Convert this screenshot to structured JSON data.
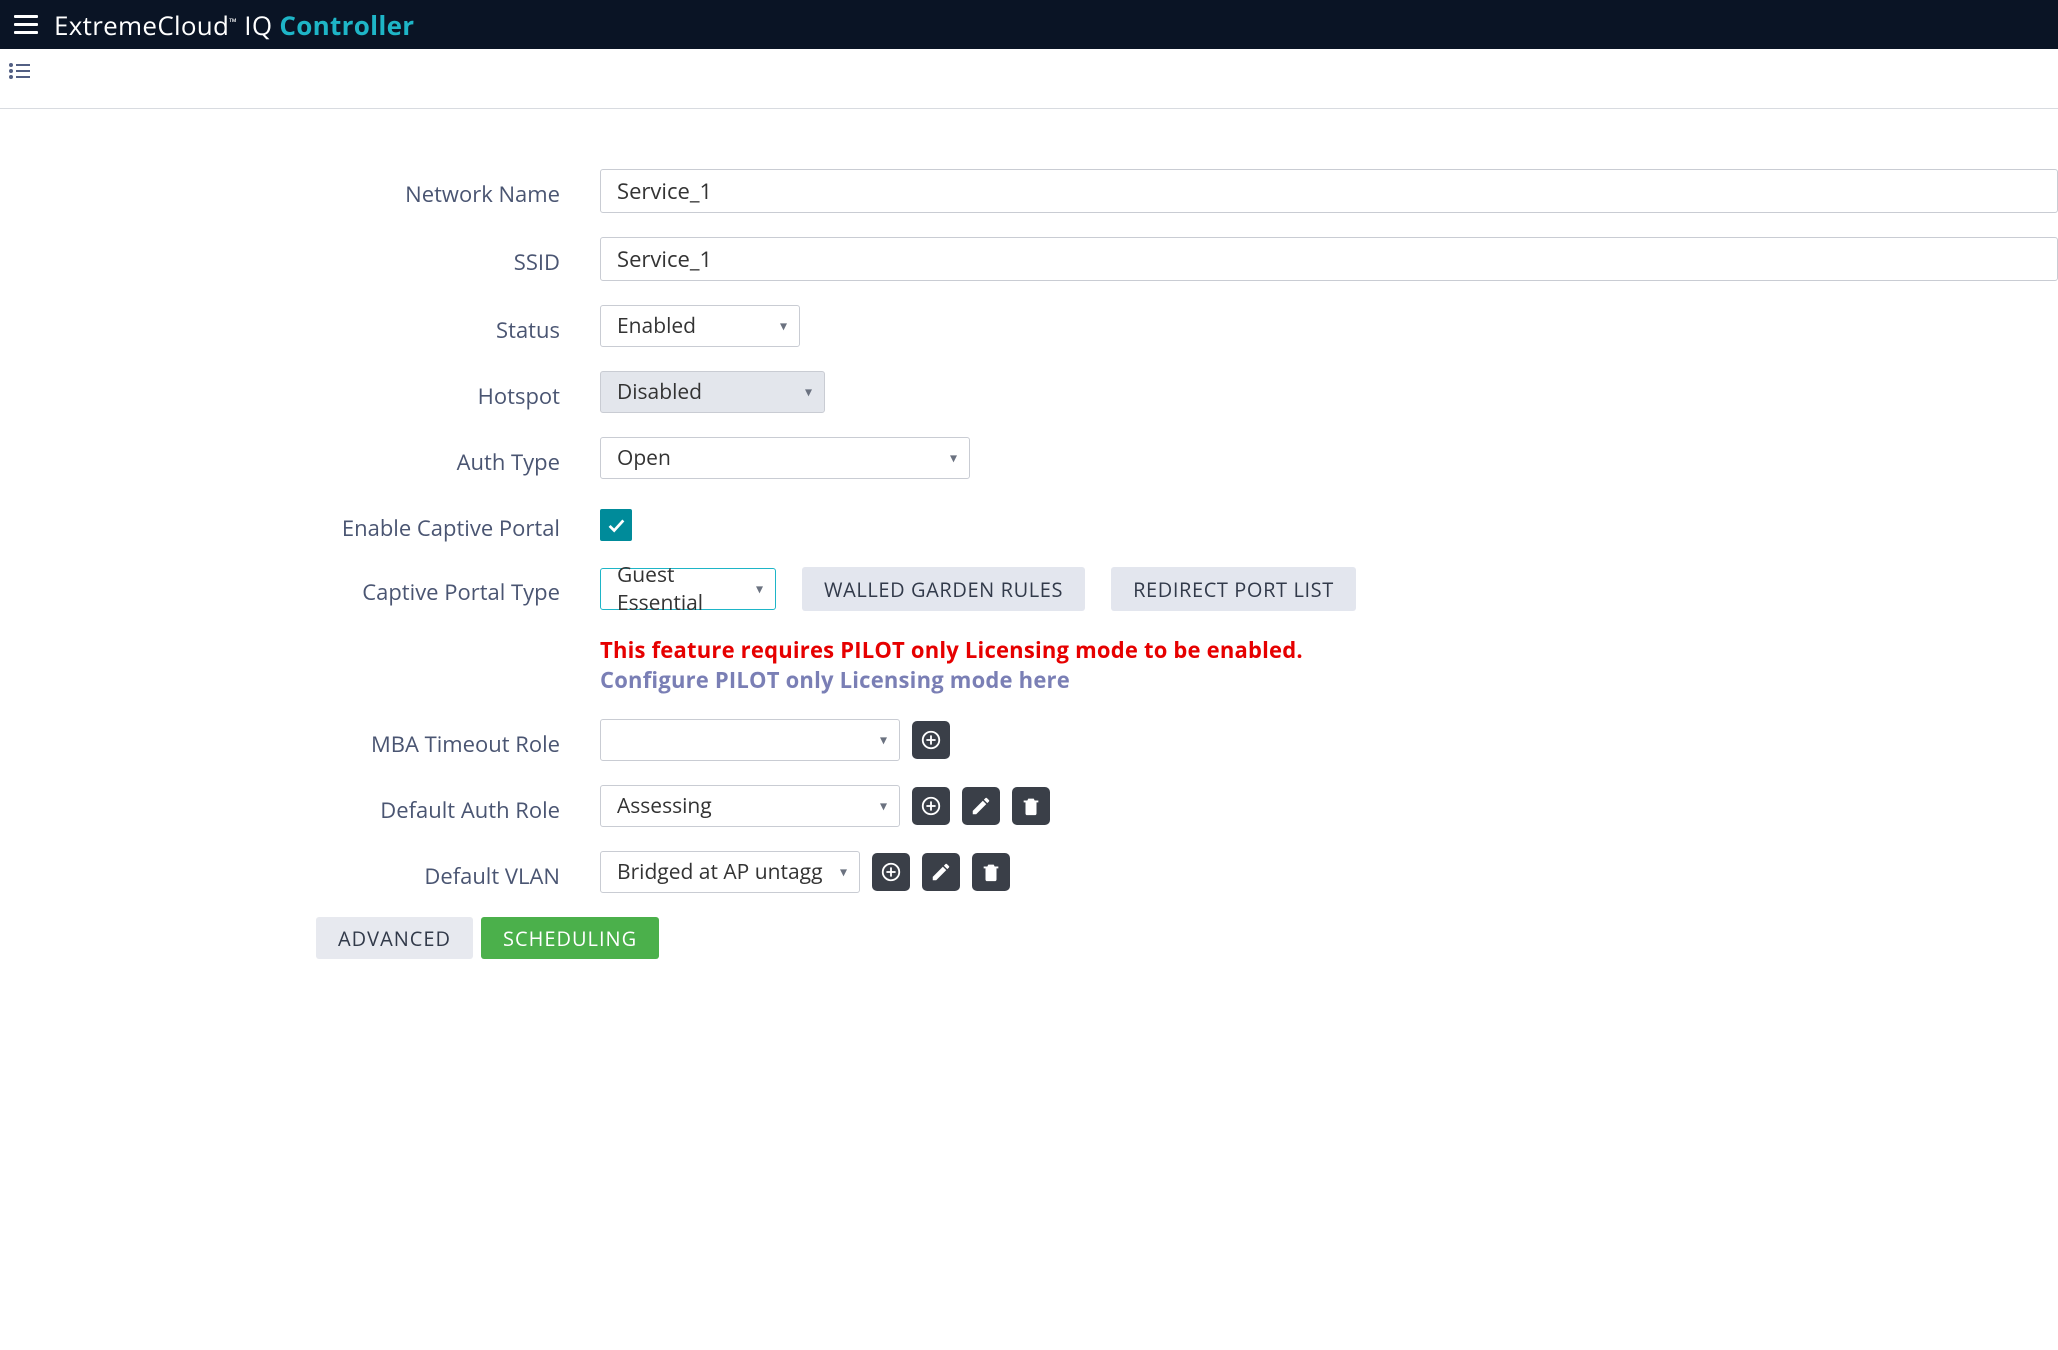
{
  "header": {
    "brand_a": "ExtremeCloud",
    "brand_tm": "™",
    "brand_iq": " IQ ",
    "brand_controller": "Controller"
  },
  "form": {
    "network_name": {
      "label": "Network Name",
      "value": "Service_1"
    },
    "ssid": {
      "label": "SSID",
      "value": "Service_1"
    },
    "status": {
      "label": "Status",
      "value": "Enabled"
    },
    "hotspot": {
      "label": "Hotspot",
      "value": "Disabled"
    },
    "auth_type": {
      "label": "Auth Type",
      "value": "Open"
    },
    "enable_captive_portal": {
      "label": "Enable Captive Portal",
      "checked": true
    },
    "captive_portal_type": {
      "label": "Captive Portal Type",
      "value": "Guest Essential",
      "btn_walled_garden": "Walled Garden Rules",
      "btn_redirect_port": "Redirect Port List",
      "warning": "This feature requires PILOT only Licensing mode to be enabled.",
      "link": "Configure PILOT only Licensing mode here"
    },
    "mba_timeout_role": {
      "label": "MBA Timeout Role",
      "value": ""
    },
    "default_auth_role": {
      "label": "Default Auth Role",
      "value": "Assessing"
    },
    "default_vlan": {
      "label": "Default VLAN",
      "value": "Bridged at AP untagged ("
    }
  },
  "footer": {
    "advanced": "ADVANCED",
    "scheduling": "SCHEDULING"
  }
}
